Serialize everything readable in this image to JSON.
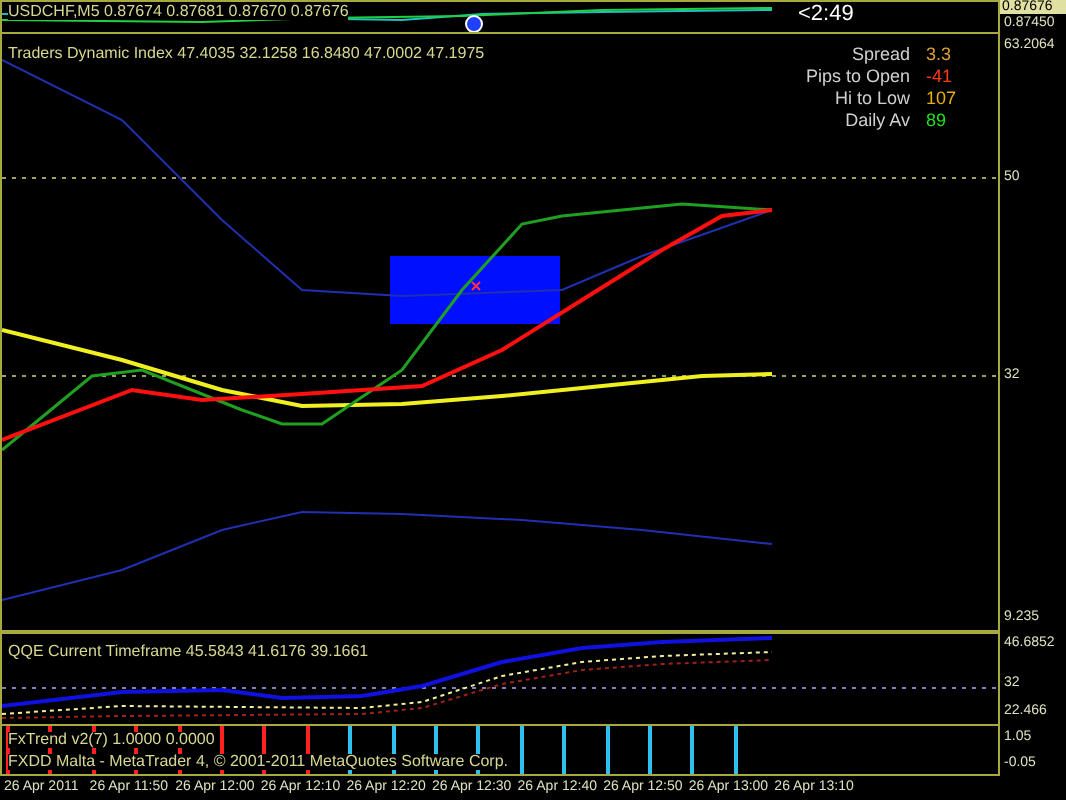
{
  "top_window": {
    "title": "USDCHF,M5 0.87674 0.87681 0.87670 0.87676",
    "timer": "<2:49",
    "axis_labels": [
      "0.87676",
      "0.87450"
    ]
  },
  "main_panel": {
    "title": "Traders Dynamic Index 47.4035 32.1258 16.8480 47.0002 47.1975",
    "info": [
      {
        "label": "Spread",
        "value": "3.3",
        "color": "#e0a030"
      },
      {
        "label": "Pips to Open",
        "value": "-41",
        "color": "#ff3a1a"
      },
      {
        "label": "Hi to Low",
        "value": "107",
        "color": "#e8b000"
      },
      {
        "label": "Daily Av",
        "value": "89",
        "color": "#20e020"
      }
    ],
    "axis_labels": [
      "63.2064",
      "50",
      "32",
      "9.235"
    ]
  },
  "qqe_panel": {
    "title": "QQE Current Timeframe 45.5843 41.6176 39.1661",
    "axis_labels": [
      "46.6852",
      "32",
      "22.466"
    ]
  },
  "trend_panel": {
    "title": "FxTrend v2(7) 1.0000 0.0000",
    "copyright": "FXDD Malta - MetaTrader 4, © 2001-2011 MetaQuotes Software Corp.",
    "axis_labels": [
      "1.05",
      "-0.05"
    ],
    "bars": [
      {
        "color": "#ff2020"
      },
      {
        "color": "#ff2020"
      },
      {
        "color": "#ff2020"
      },
      {
        "color": "#ff2020"
      },
      {
        "color": "#ff2020"
      },
      {
        "color": "#ff2020"
      },
      {
        "color": "#ff2020"
      },
      {
        "color": "#ff2020"
      },
      {
        "color": "#30c0f0"
      },
      {
        "color": "#30c0f0"
      },
      {
        "color": "#30c0f0"
      },
      {
        "color": "#30c0f0"
      },
      {
        "color": "#30c0f0"
      },
      {
        "color": "#30c0f0"
      },
      {
        "color": "#30c0f0"
      },
      {
        "color": "#30c0f0"
      },
      {
        "color": "#30c0f0"
      },
      {
        "color": "#30c0f0"
      }
    ]
  },
  "time_axis": [
    "26 Apr 2011",
    "26 Apr 11:50",
    "26 Apr 12:00",
    "26 Apr 12:10",
    "26 Apr 12:20",
    "26 Apr 12:30",
    "26 Apr 12:40",
    "26 Apr 12:50",
    "26 Apr 13:00",
    "26 Apr 13:10"
  ]
}
